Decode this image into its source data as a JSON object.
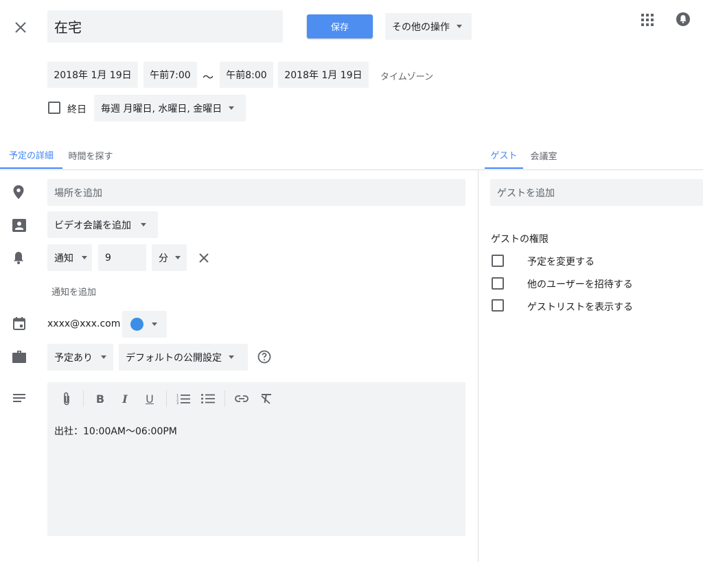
{
  "header": {
    "title_value": "在宅",
    "save_label": "保存",
    "more_actions_label": "その他の操作"
  },
  "datetime": {
    "start_date": "2018年 1月 19日",
    "start_time": "午前7:00",
    "separator": "〜",
    "end_time": "午前8:00",
    "end_date": "2018年 1月 19日",
    "timezone_label": "タイムゾーン",
    "all_day_label": "終日",
    "recurrence": "毎週 月曜日, 水曜日, 金曜日"
  },
  "tabs": {
    "details": "予定の詳細",
    "find_time": "時間を探す",
    "guests": "ゲスト",
    "rooms": "会議室"
  },
  "details": {
    "location_placeholder": "場所を追加",
    "video_conference": "ビデオ会議を追加",
    "notification_type": "通知",
    "notification_value": "9",
    "notification_unit": "分",
    "add_notification": "通知を追加",
    "calendar_email": "xxxx@xxx.com",
    "availability": "予定あり",
    "visibility": "デフォルトの公開設定",
    "description": "出社：10:00AM〜06:00PM"
  },
  "guests": {
    "add_placeholder": "ゲストを追加",
    "permissions_title": "ゲストの権限",
    "permissions": [
      {
        "label": "予定を変更する"
      },
      {
        "label": "他のユーザーを招待する"
      },
      {
        "label": "ゲストリストを表示する"
      }
    ]
  },
  "colors": {
    "accent": "#4285f4",
    "event_color": "#3b8ee8",
    "field_bg": "#f1f3f4"
  }
}
